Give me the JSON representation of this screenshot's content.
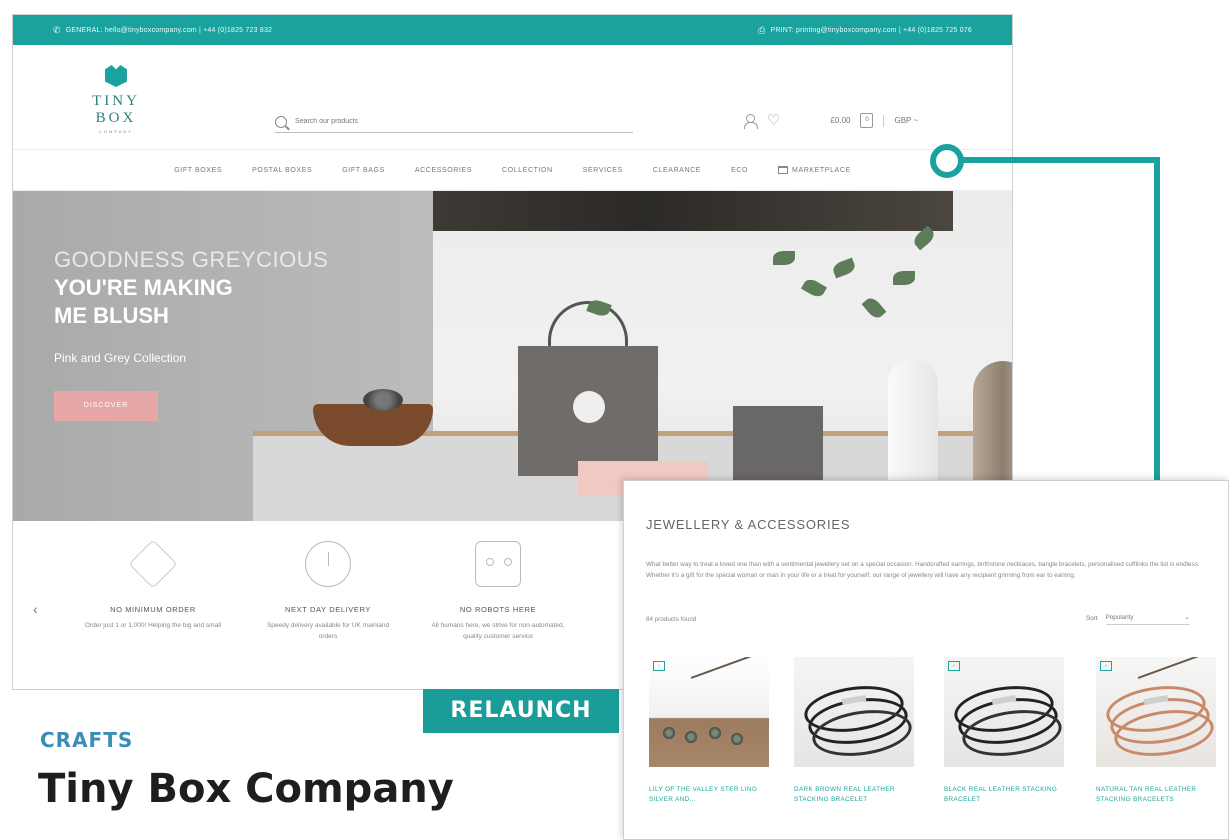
{
  "site": {
    "topbar": {
      "left": "GENERAL: hello@tinyboxcompany.com | +44 (0)1825 723 832",
      "right": "PRINT: printing@tinyboxcompany.com | +44 (0)1825 725 076"
    },
    "logo": {
      "name": "TINY BOX",
      "sub": "COMPANY"
    },
    "search": {
      "placeholder": "Search our products"
    },
    "header": {
      "cart_total": "£0.00",
      "cart_count": "0",
      "currency": "GBP ~"
    },
    "nav": [
      "GIFT BOXES",
      "POSTAL BOXES",
      "GIFT BAGS",
      "ACCESSORIES",
      "COLLECTION",
      "SERVICES",
      "CLEARANCE",
      "ECO",
      "MARKETPLACE"
    ],
    "hero": {
      "line1": "GOODNESS GREYCIOUS",
      "line2": "YOU'RE MAKING",
      "line3": "ME BLUSH",
      "subtitle": "Pink and Grey Collection",
      "button": "DISCOVER"
    },
    "features": [
      {
        "title": "NO MINIMUM ORDER",
        "desc": "Order just 1 or 1,000! Helping the big and small",
        "icon": "box-icon"
      },
      {
        "title": "NEXT DAY DELIVERY",
        "desc": "Speedy delivery available for UK mainland orders",
        "icon": "clock-icon"
      },
      {
        "title": "NO ROBOTS HERE",
        "desc": "All humans here, we strive for non-automated, quality customer service",
        "icon": "robot-icon"
      }
    ],
    "arrow_left": "‹"
  },
  "labels": {
    "relaunch": "RELAUNCH",
    "category": "CRAFTS",
    "company": "Tiny Box Company"
  },
  "inset": {
    "title": "JEWELLERY & ACCESSORIES",
    "description": "What better way to treat a loved one than with a sentimental jewellery set on a special occasion. Handcrafted earrings, birthstone necklaces, bangle bracelets, personalised cufflinks the list is endless. Whether it's a gift for the special woman or man in your life or a treat for yourself, our range of jewellery will have any recipient grinning from ear to earring.",
    "count": "84 products found",
    "sort_label": "Sort",
    "sort_value": "Popularity",
    "products": [
      "LILY OF THE VALLEY STER LING SILVER AND...",
      "DARK BROWN REAL LEATHER STACKING BRACELET",
      "BLACK REAL LEATHER STACKING BRACELET",
      "NATURAL TAN REAL LEATHER STACKING BRACELETS"
    ]
  },
  "colors": {
    "accent": "#1aa39e",
    "hero_button": "#e8a7a7",
    "category": "#3a8db7"
  }
}
